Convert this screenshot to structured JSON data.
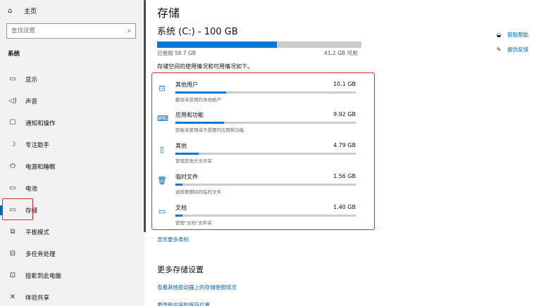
{
  "sidebar": {
    "home": {
      "icon": "home-icon",
      "label": "主页"
    },
    "search": {
      "placeholder": "查找设置",
      "icon": "search-icon"
    },
    "section": "系统",
    "items": [
      {
        "icon": "display-icon",
        "label": "显示"
      },
      {
        "icon": "sound-icon",
        "label": "声音"
      },
      {
        "icon": "notification-icon",
        "label": "通知和操作"
      },
      {
        "icon": "focus-assist-icon",
        "label": "专注助手"
      },
      {
        "icon": "power-icon",
        "label": "电源和睡眠"
      },
      {
        "icon": "battery-icon",
        "label": "电池"
      },
      {
        "icon": "storage-icon",
        "label": "存储"
      },
      {
        "icon": "tablet-mode-icon",
        "label": "平板模式"
      },
      {
        "icon": "multitasking-icon",
        "label": "多任务处理"
      },
      {
        "icon": "project-icon",
        "label": "投影到此电脑"
      },
      {
        "icon": "shared-experience-icon",
        "label": "体验共享"
      }
    ],
    "selected_index": 6
  },
  "main": {
    "title": "存储",
    "drive": "系统 (C:) - 100 GB",
    "usage_fraction": 0.587,
    "used_label": "已使用 58.7 GB",
    "free_label": "41.2 GB 可用",
    "description": "存储空间的使用情况和可用情况如下。",
    "categories": [
      {
        "icon": "users-icon",
        "name": "其他用户",
        "size": "10.1 GB",
        "fraction": 0.28,
        "sub": "删除未使用的本地帐户"
      },
      {
        "icon": "apps-icon",
        "name": "应用和功能",
        "size": "9.92 GB",
        "fraction": 0.27,
        "sub": "卸载未使用或不想要的应用和功能"
      },
      {
        "icon": "other-icon",
        "name": "其他",
        "size": "4.79 GB",
        "fraction": 0.13,
        "sub": "管理其他大文件夹"
      },
      {
        "icon": "trash-icon",
        "name": "临时文件",
        "size": "1.56 GB",
        "fraction": 0.04,
        "sub": "选择要删除的临时文件"
      },
      {
        "icon": "documents-icon",
        "name": "文档",
        "size": "1.40 GB",
        "fraction": 0.04,
        "sub": "管理\"文档\"文件夹"
      }
    ],
    "show_more": "显示更多类别",
    "more_settings_title": "更多存储设置",
    "link_other_drives": "查看其他驱动器上的存储使用情况",
    "link_truncated": "更改新内容的保存位置"
  },
  "help": {
    "items": [
      {
        "icon": "get-help-icon",
        "label": "获取帮助"
      },
      {
        "icon": "feedback-icon",
        "label": "提供反馈"
      }
    ]
  },
  "colors": {
    "accent": "#0078d7",
    "highlight": "#e0262b",
    "link": "#0063b1"
  }
}
